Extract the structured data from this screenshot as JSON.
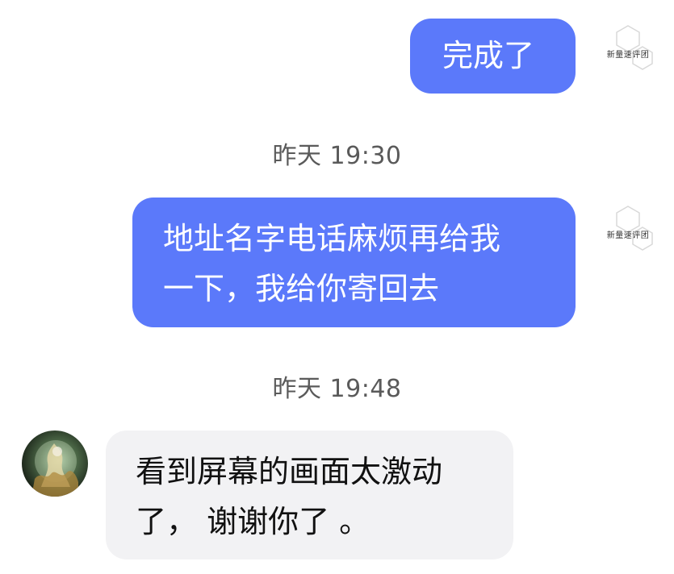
{
  "messages": [
    {
      "id": "m1",
      "direction": "outgoing",
      "text": "完成了"
    },
    {
      "id": "m2",
      "direction": "outgoing",
      "text": "地址名字电话麻烦再给我\n一下，我给你寄回去"
    },
    {
      "id": "m3",
      "direction": "incoming",
      "text": "看到屏幕的画面太激动\n了， 谢谢你了 。"
    }
  ],
  "timestamps": [
    "昨天 19:30",
    "昨天 19:48"
  ],
  "sender_logo_text": "新量速评团",
  "colors": {
    "outgoing_bubble": "#5b79fa",
    "incoming_bubble": "#f2f2f4",
    "timestamp_text": "#5a5a5a"
  }
}
